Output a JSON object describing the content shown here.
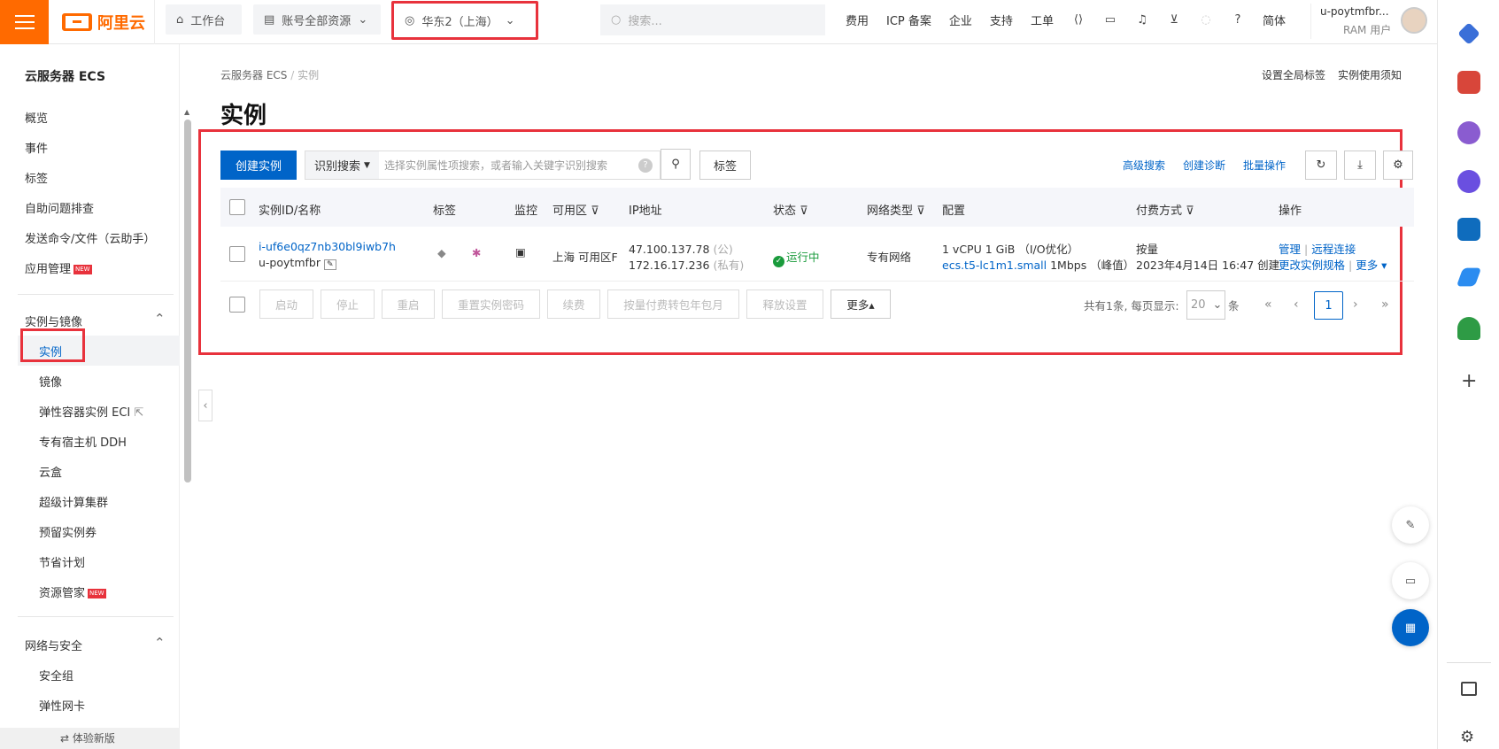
{
  "topbar": {
    "brand": "阿里云",
    "workbench": "工作台",
    "resource_scope": "账号全部资源",
    "region": "华东2（上海）",
    "search_placeholder": "搜索...",
    "nav": [
      "费用",
      "ICP 备案",
      "企业",
      "支持",
      "工单"
    ],
    "lang": "简体",
    "user_name": "u-poytmfbr...",
    "user_role": "RAM 用户"
  },
  "sidebar": {
    "title": "云服务器 ECS",
    "items_top": [
      "概览",
      "事件",
      "标签",
      "自助问题排查",
      "发送命令/文件（云助手）",
      "应用管理"
    ],
    "group1": "实例与镜像",
    "group1_items": [
      "实例",
      "镜像",
      "弹性容器实例 ECI",
      "专有宿主机 DDH",
      "云盒",
      "超级计算集群",
      "预留实例券",
      "节省计划",
      "资源管家"
    ],
    "group2": "网络与安全",
    "group2_items": [
      "安全组",
      "弹性网卡"
    ],
    "new_badge": "NEW",
    "bottom": "⇄ 体验新版"
  },
  "breadcrumb": {
    "root": "云服务器 ECS",
    "sep": "/",
    "current": "实例"
  },
  "top_links": [
    "设置全局标签",
    "实例使用须知"
  ],
  "page_title": "实例",
  "toolbar": {
    "create": "创建实例",
    "search_mode": "识别搜索",
    "search_placeholder": "选择实例属性项搜索，或者输入关键字识别搜索",
    "tag": "标签",
    "links": [
      "高级搜索",
      "创建诊断",
      "批量操作"
    ]
  },
  "table": {
    "columns": [
      "实例ID/名称",
      "标签",
      "监控",
      "可用区",
      "IP地址",
      "状态",
      "网络类型",
      "配置",
      "付费方式",
      "操作"
    ],
    "row": {
      "id": "i-uf6e0qz7nb30bl9iwb7h",
      "name": "u-poytmfbr",
      "zone": "上海 可用区F",
      "ip_public": "47.100.137.78",
      "ip_public_tag": "(公)",
      "ip_private": "172.16.17.236",
      "ip_private_tag": "(私有)",
      "status": "运行中",
      "network": "专有网络",
      "config1": "1 vCPU 1 GiB （I/O优化）",
      "config_spec": "ecs.t5-lc1m1.small",
      "config_bw": "1Mbps （峰值）",
      "pay": "按量",
      "created": "2023年4月14日 16:47 创建",
      "op_manage": "管理",
      "op_remote": "远程连接",
      "op_change": "更改实例规格",
      "op_more": "更多 ▾"
    }
  },
  "bulk": [
    "启动",
    "停止",
    "重启",
    "重置实例密码",
    "续费",
    "按量付费转包年包月",
    "释放设置",
    "更多▴"
  ],
  "pager": {
    "total": "共有1条, 每页显示:",
    "size": "20",
    "unit": "条",
    "current": "1"
  }
}
